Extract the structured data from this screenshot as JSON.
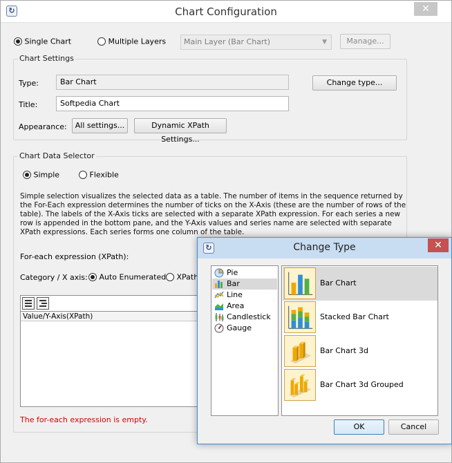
{
  "window": {
    "title": "Chart Configuration",
    "close_glyph": "✕",
    "icon_glyph": "↻"
  },
  "mode": {
    "single_label": "Single Chart",
    "multiple_label": "Multiple Layers",
    "layer_select_value": "Main Layer (Bar Chart)",
    "manage_label": "Manage..."
  },
  "chart_settings": {
    "group_title": "Chart Settings",
    "type_label": "Type:",
    "type_value": "Bar Chart",
    "change_type_label": "Change type...",
    "title_label": "Title:",
    "title_value": "Softpedia Chart",
    "appearance_label": "Appearance:",
    "all_settings_label": "All settings...",
    "xpath_settings_label": "Dynamic XPath Settings..."
  },
  "data_selector": {
    "group_title": "Chart Data Selector",
    "simple_label": "Simple",
    "flexible_label": "Flexible",
    "description": "Simple selection visualizes the selected data as a table. The number of items in the sequence returned by the For-Each expression determines the number of ticks on the X-Axis (these are the number of rows of the table). The labels of the X-Axis ticks are selected with a separate XPath expression. For each series a new row is appended in the bottom pane, and the Y-Axis values and series name are selected with separate XPath expressions. Each series forms one column of the table.",
    "foreach_label": "For-each expression (XPath):",
    "category_label": "Category / X axis:",
    "auto_enum_label": "Auto Enumerated",
    "xpath_label": "XPath",
    "grid_header": "Value/Y-Axis(XPath)",
    "error": "The for-each expression is empty."
  },
  "dialog": {
    "title": "Change Type",
    "close_glyph": "✕",
    "icon_glyph": "↻",
    "types": [
      {
        "label": "Pie",
        "icon": "pie-chart-icon"
      },
      {
        "label": "Bar",
        "icon": "bar-chart-icon"
      },
      {
        "label": "Line",
        "icon": "line-chart-icon"
      },
      {
        "label": "Area",
        "icon": "area-chart-icon"
      },
      {
        "label": "Candlestick",
        "icon": "candlestick-chart-icon"
      },
      {
        "label": "Gauge",
        "icon": "gauge-chart-icon"
      }
    ],
    "selected_type": "Bar",
    "variants": [
      {
        "label": "Bar Chart"
      },
      {
        "label": "Stacked Bar Chart"
      },
      {
        "label": "Bar Chart 3d"
      },
      {
        "label": "Bar Chart 3d Grouped"
      }
    ],
    "selected_variant": "Bar Chart",
    "ok_label": "OK",
    "cancel_label": "Cancel"
  },
  "colors": {
    "accent": "#3b8fd9",
    "error": "#d60000",
    "thumb_bg": "#fdf3cf",
    "bar_orange": "#f0a800",
    "bar_blue": "#2f8fd6",
    "bar_green": "#54b046"
  }
}
